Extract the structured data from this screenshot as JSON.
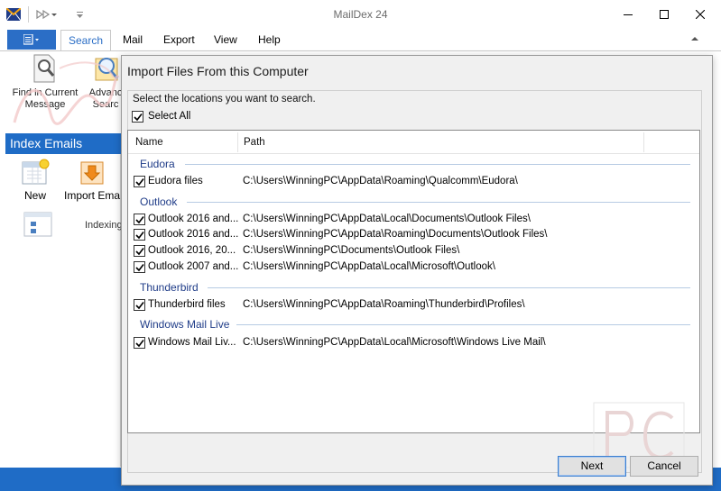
{
  "app": {
    "title": "MailDex 24",
    "colors": {
      "accent": "#1f6cc6",
      "group_text": "#1f3c88"
    }
  },
  "menu": {
    "file_icon": "file-menu-icon",
    "tabs": [
      {
        "label": "Search",
        "active": true
      },
      {
        "label": "Mail",
        "active": false
      },
      {
        "label": "Export",
        "active": false
      },
      {
        "label": "View",
        "active": false
      },
      {
        "label": "Help",
        "active": false
      }
    ]
  },
  "ribbon": {
    "find_line1": "Find in Current",
    "find_line2": "Message",
    "adv_line1": "Advanc",
    "adv_line2": "Searc"
  },
  "index_panel": {
    "header": "Index Emails",
    "new_label": "New",
    "import_label": "Import Ema",
    "indexing_text": "Indexing"
  },
  "dialog": {
    "title": "Import Files From this Computer",
    "instruction": "Select the locations you want to search.",
    "select_all_label": "Select All",
    "select_all_checked": true,
    "columns": {
      "name": "Name",
      "path": "Path"
    },
    "groups": [
      {
        "label": "Eudora",
        "rows": [
          {
            "name": "Eudora files",
            "path": "C:\\Users\\WinningPC\\AppData\\Roaming\\Qualcomm\\Eudora\\",
            "checked": true
          }
        ]
      },
      {
        "label": "Outlook",
        "rows": [
          {
            "name": "Outlook 2016 and...",
            "path": "C:\\Users\\WinningPC\\AppData\\Local\\Documents\\Outlook Files\\",
            "checked": true
          },
          {
            "name": "Outlook 2016 and...",
            "path": "C:\\Users\\WinningPC\\AppData\\Roaming\\Documents\\Outlook Files\\",
            "checked": true
          },
          {
            "name": "Outlook 2016, 20...",
            "path": "C:\\Users\\WinningPC\\Documents\\Outlook Files\\",
            "checked": true
          },
          {
            "name": "Outlook 2007 and...",
            "path": "C:\\Users\\WinningPC\\AppData\\Local\\Microsoft\\Outlook\\",
            "checked": true
          }
        ]
      },
      {
        "label": "Thunderbird",
        "rows": [
          {
            "name": "Thunderbird files",
            "path": "C:\\Users\\WinningPC\\AppData\\Roaming\\Thunderbird\\Profiles\\",
            "checked": true
          }
        ]
      },
      {
        "label": "Windows Mail Live",
        "rows": [
          {
            "name": "Windows Mail Liv...",
            "path": "C:\\Users\\WinningPC\\AppData\\Local\\Microsoft\\Windows Live Mail\\",
            "checked": true
          }
        ]
      }
    ],
    "next_label": "Next",
    "cancel_label": "Cancel"
  }
}
